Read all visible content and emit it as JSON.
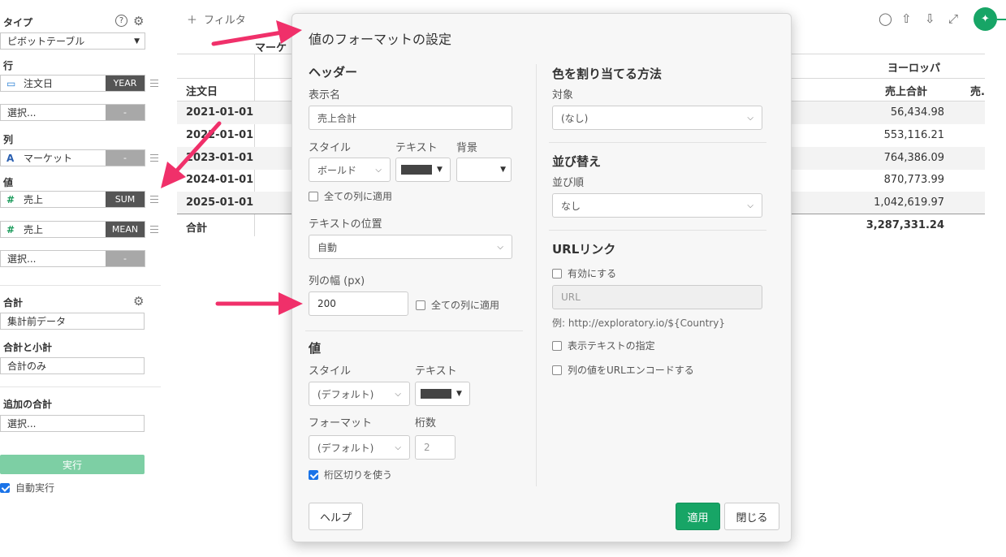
{
  "sidebar": {
    "type_label": "タイプ",
    "type_value": "ピボットテーブル",
    "rows_label": "行",
    "row_field": {
      "name": "注文日",
      "agg": "YEAR"
    },
    "row_select": {
      "name": "選択...",
      "agg": "-"
    },
    "cols_label": "列",
    "col_field": {
      "name": "マーケット",
      "agg": "-"
    },
    "values_label": "値",
    "value_fields": [
      {
        "name": "売上",
        "agg": "SUM"
      },
      {
        "name": "売上",
        "agg": "MEAN"
      }
    ],
    "value_select": {
      "name": "選択...",
      "agg": "-"
    },
    "total_label": "合計",
    "total_value": "集計前データ",
    "subtotal_label": "合計と小計",
    "subtotal_value": "合計のみ",
    "extra_total_label": "追加の合計",
    "extra_total_value": "選択...",
    "run_label": "実行",
    "auto_run_label": "自動実行"
  },
  "main": {
    "filter_label": "フィルタ",
    "col_header_market": "マーケ",
    "region_header": "ヨーロッパ",
    "row_header": "注文日",
    "value_header": "売上合計",
    "value_header_cut": "売.",
    "rows": [
      {
        "date": "2021-01-01",
        "value": "56,434.98"
      },
      {
        "date": "2022-01-01",
        "value": "553,116.21"
      },
      {
        "date": "2023-01-01",
        "value": "764,386.09"
      },
      {
        "date": "2024-01-01",
        "value": "870,773.99"
      },
      {
        "date": "2025-01-01",
        "value": "1,042,619.97"
      }
    ],
    "total_row": {
      "label": "合計",
      "value": "3,287,331.24"
    }
  },
  "dialog": {
    "title": "値のフォーマットの設定",
    "header_section": "ヘッダー",
    "display_name_label": "表示名",
    "display_name_value": "売上合計",
    "style_label": "スタイル",
    "text_label": "テキスト",
    "bg_label": "背景",
    "style_value": "ボールド",
    "apply_all_cols": "全ての列に適用",
    "text_pos_label": "テキストの位置",
    "text_pos_value": "自動",
    "col_width_label": "列の幅 (px)",
    "col_width_value": "200",
    "apply_all_cols_2": "全ての列に適用",
    "value_section": "値",
    "value_style_label": "スタイル",
    "value_text_label": "テキスト",
    "value_style_value": "(デフォルト)",
    "format_label": "フォーマット",
    "digits_label": "桁数",
    "format_value": "(デフォルト)",
    "digits_value": "2",
    "thousands_sep": "桁区切りを使う",
    "color_section": "色を割り当てる方法",
    "target_label": "対象",
    "target_value": "(なし)",
    "sort_section": "並び替え",
    "sort_order_label": "並び順",
    "sort_order_value": "なし",
    "url_section": "URLリンク",
    "enable_label": "有効にする",
    "url_placeholder": "URL",
    "url_example": "例: http://exploratory.io/${Country}",
    "display_text_label": "表示テキストの指定",
    "url_encode_label": "列の値をURLエンコードする",
    "help_button": "ヘルプ",
    "apply_button": "適用",
    "close_button": "閉じる"
  },
  "colors": {
    "accent_green": "#17a566",
    "arrow_pink": "#f0306a",
    "checkbox_blue": "#1a73e8"
  }
}
